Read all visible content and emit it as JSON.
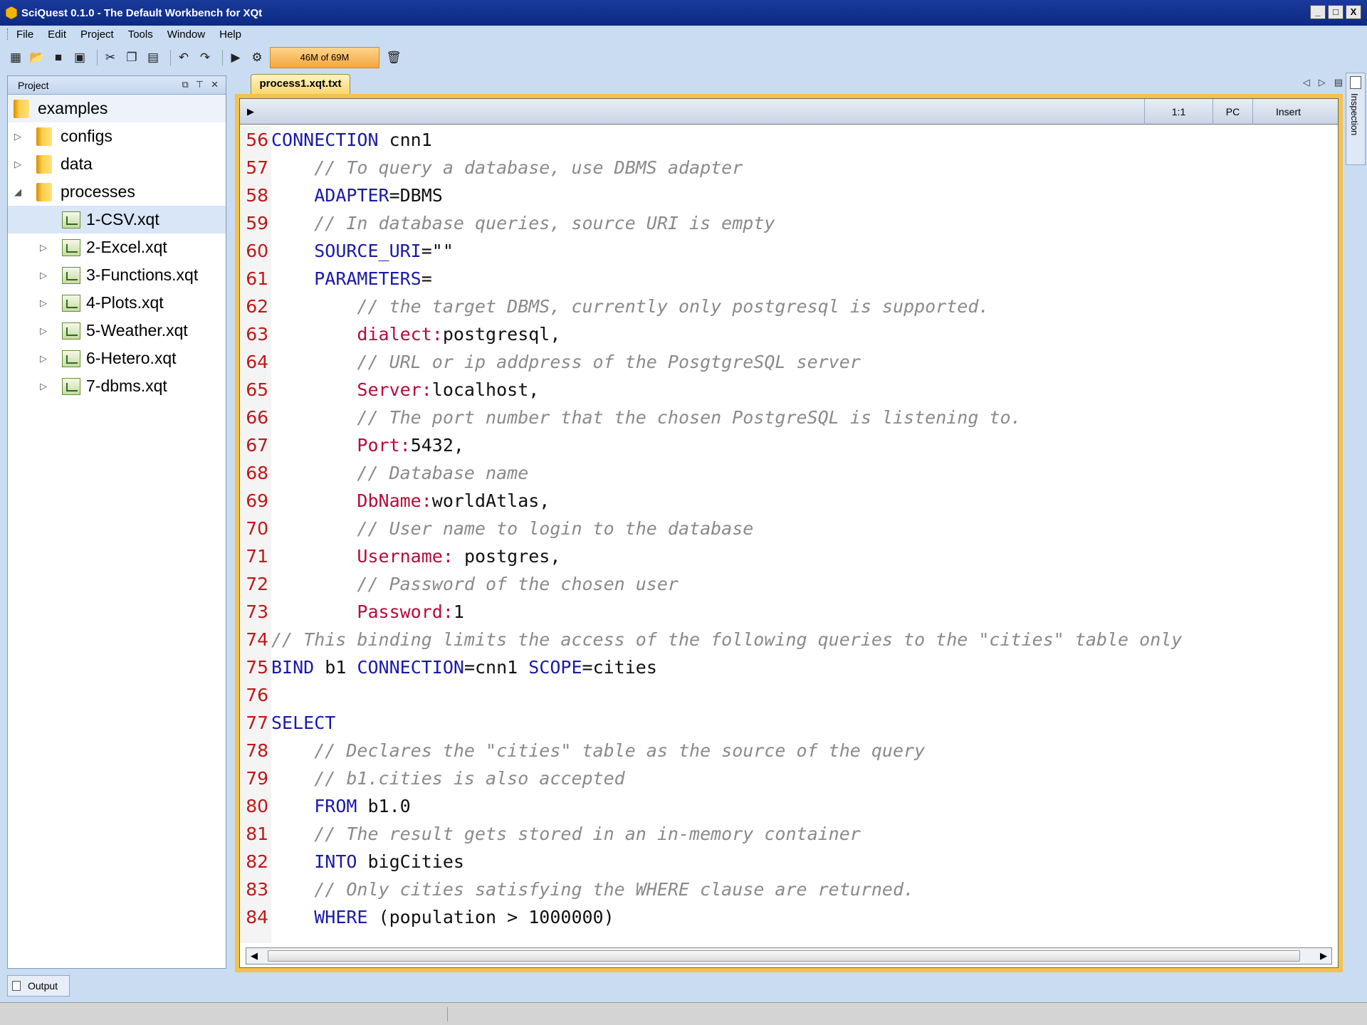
{
  "window": {
    "title": "SciQuest 0.1.0 - The Default Workbench for XQt",
    "controls": [
      "_",
      "□",
      "X"
    ]
  },
  "menu": [
    "File",
    "Edit",
    "Project",
    "Tools",
    "Window",
    "Help"
  ],
  "toolbar": {
    "memory_label": "46M of 69M",
    "icons": [
      "new-icon",
      "open-icon",
      "save-icon",
      "save-all-icon",
      "cut-icon",
      "copy-icon",
      "paste-icon",
      "undo-icon",
      "redo-icon",
      "run-icon",
      "debug-icon",
      "garbage-collect-icon"
    ]
  },
  "project_panel": {
    "title": "Project",
    "tree": [
      {
        "label": "examples",
        "kind": "root"
      },
      {
        "label": "configs",
        "kind": "folder",
        "expanded": false
      },
      {
        "label": "data",
        "kind": "folder",
        "expanded": false
      },
      {
        "label": "processes",
        "kind": "folder",
        "expanded": true
      },
      {
        "label": "1-CSV.xqt",
        "kind": "file",
        "selected": true
      },
      {
        "label": "2-Excel.xqt",
        "kind": "file"
      },
      {
        "label": "3-Functions.xqt",
        "kind": "file"
      },
      {
        "label": "4-Plots.xqt",
        "kind": "file"
      },
      {
        "label": "5-Weather.xqt",
        "kind": "file"
      },
      {
        "label": "6-Hetero.xqt",
        "kind": "file"
      },
      {
        "label": "7-dbms.xqt",
        "kind": "file"
      }
    ]
  },
  "editor": {
    "tab_label": "process1.xqt.txt",
    "status": {
      "position": "1:1",
      "line_ending": "PC",
      "mode": "Insert"
    },
    "lines": [
      {
        "n": "56",
        "tokens": [
          [
            "kw",
            "CONNECTION"
          ],
          [
            "tx",
            " cnn1"
          ]
        ]
      },
      {
        "n": "57",
        "tokens": [
          [
            "tx",
            "    "
          ],
          [
            "cm",
            "// To query a database, use DBMS adapter"
          ]
        ]
      },
      {
        "n": "58",
        "tokens": [
          [
            "tx",
            "    "
          ],
          [
            "kw",
            "ADAPTER"
          ],
          [
            "tx",
            "=DBMS"
          ]
        ]
      },
      {
        "n": "59",
        "tokens": [
          [
            "tx",
            "    "
          ],
          [
            "cm",
            "// In database queries, source URI is empty"
          ]
        ]
      },
      {
        "n": "60",
        "tokens": [
          [
            "tx",
            "    "
          ],
          [
            "kw",
            "SOURCE_URI"
          ],
          [
            "tx",
            "=\"\""
          ]
        ]
      },
      {
        "n": "61",
        "tokens": [
          [
            "tx",
            "    "
          ],
          [
            "kw",
            "PARAMETERS"
          ],
          [
            "tx",
            "="
          ]
        ]
      },
      {
        "n": "62",
        "tokens": [
          [
            "tx",
            "        "
          ],
          [
            "cm",
            "// the target DBMS, currently only postgresql is supported."
          ]
        ]
      },
      {
        "n": "63",
        "tokens": [
          [
            "tx",
            "        "
          ],
          [
            "pk",
            "dialect:"
          ],
          [
            "tx",
            "postgresql,"
          ]
        ]
      },
      {
        "n": "64",
        "tokens": [
          [
            "tx",
            "        "
          ],
          [
            "cm",
            "// URL or ip addpress of the PosgtgreSQL server"
          ]
        ]
      },
      {
        "n": "65",
        "tokens": [
          [
            "tx",
            "        "
          ],
          [
            "pk",
            "Server:"
          ],
          [
            "tx",
            "localhost,"
          ]
        ]
      },
      {
        "n": "66",
        "tokens": [
          [
            "tx",
            "        "
          ],
          [
            "cm",
            "// The port number that the chosen PostgreSQL is listening to."
          ]
        ]
      },
      {
        "n": "67",
        "tokens": [
          [
            "tx",
            "        "
          ],
          [
            "pk",
            "Port:"
          ],
          [
            "tx",
            "5432,"
          ]
        ]
      },
      {
        "n": "68",
        "tokens": [
          [
            "tx",
            "        "
          ],
          [
            "cm",
            "// Database name"
          ]
        ]
      },
      {
        "n": "69",
        "tokens": [
          [
            "tx",
            "        "
          ],
          [
            "pk",
            "DbName:"
          ],
          [
            "tx",
            "worldAtlas,"
          ]
        ]
      },
      {
        "n": "70",
        "tokens": [
          [
            "tx",
            "        "
          ],
          [
            "cm",
            "// User name to login to the database"
          ]
        ]
      },
      {
        "n": "71",
        "tokens": [
          [
            "tx",
            "        "
          ],
          [
            "pk",
            "Username:"
          ],
          [
            "tx",
            " postgres,"
          ]
        ]
      },
      {
        "n": "72",
        "tokens": [
          [
            "tx",
            "        "
          ],
          [
            "cm",
            "// Password of the chosen user"
          ]
        ]
      },
      {
        "n": "73",
        "tokens": [
          [
            "tx",
            "        "
          ],
          [
            "pk",
            "Password:"
          ],
          [
            "tx",
            "1"
          ]
        ]
      },
      {
        "n": "74",
        "tokens": [
          [
            "cm",
            "// This binding limits the access of the following queries to the \"cities\" table only"
          ]
        ]
      },
      {
        "n": "75",
        "tokens": [
          [
            "kw",
            "BIND"
          ],
          [
            "tx",
            " b1 "
          ],
          [
            "kw",
            "CONNECTION"
          ],
          [
            "tx",
            "=cnn1 "
          ],
          [
            "kw",
            "SCOPE"
          ],
          [
            "tx",
            "=cities"
          ]
        ]
      },
      {
        "n": "76",
        "tokens": []
      },
      {
        "n": "77",
        "tokens": [
          [
            "kw",
            "SELECT"
          ]
        ]
      },
      {
        "n": "78",
        "tokens": [
          [
            "tx",
            "    "
          ],
          [
            "cm",
            "// Declares the \"cities\" table as the source of the query"
          ]
        ]
      },
      {
        "n": "79",
        "tokens": [
          [
            "tx",
            "    "
          ],
          [
            "cm",
            "// b1.cities is also accepted"
          ]
        ]
      },
      {
        "n": "80",
        "tokens": [
          [
            "tx",
            "    "
          ],
          [
            "kw",
            "FROM"
          ],
          [
            "tx",
            " b1.0"
          ]
        ]
      },
      {
        "n": "81",
        "tokens": [
          [
            "tx",
            "    "
          ],
          [
            "cm",
            "// The result gets stored in an in-memory container"
          ]
        ]
      },
      {
        "n": "82",
        "tokens": [
          [
            "tx",
            "    "
          ],
          [
            "kw",
            "INTO"
          ],
          [
            "tx",
            " bigCities"
          ]
        ]
      },
      {
        "n": "83",
        "tokens": [
          [
            "tx",
            "    "
          ],
          [
            "cm",
            "// Only cities satisfying the WHERE clause are returned."
          ]
        ]
      },
      {
        "n": "84",
        "tokens": [
          [
            "tx",
            "    "
          ],
          [
            "kw",
            "WHERE"
          ],
          [
            "tx",
            " (population > 1000000)"
          ]
        ]
      }
    ]
  },
  "side_panel": {
    "label": "Inspection"
  },
  "bottom": {
    "output_tab": "Output"
  }
}
